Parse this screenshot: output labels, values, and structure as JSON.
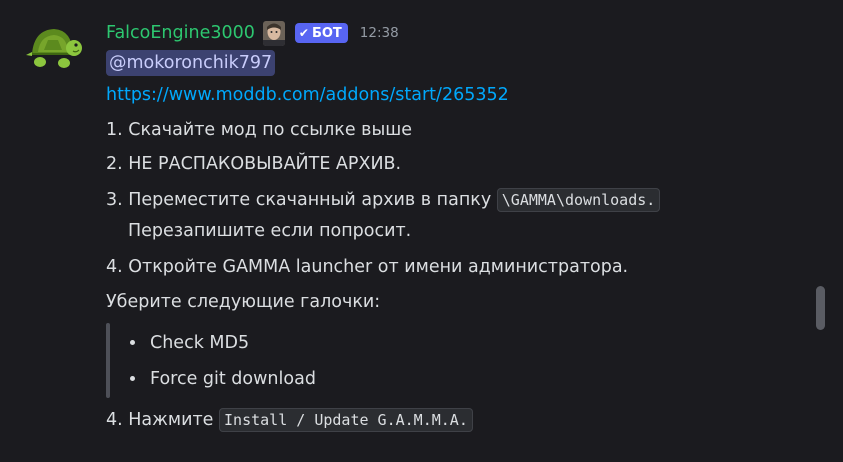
{
  "message": {
    "author": "FalcoEngine3000",
    "bot_tag": "БОТ",
    "bot_check": "✔",
    "timestamp": "12:38",
    "mention": "@mokoronchik797",
    "link": "https://www.moddb.com/addons/start/265352",
    "steps": {
      "s1": "1. Скачайте мод по ссылке выше",
      "s2": "2. НЕ РАСПАКОВЫВАЙТЕ АРХИВ.",
      "s3_prefix": "3. Переместите скачанный архив в папку ",
      "s3_code": "\\GAMMA\\downloads.",
      "s3_cont": "Перезапишите если попросит.",
      "s4": "4. Откройте GAMMA launcher от имени администратора.",
      "uncheck_intro": "Уберите следующие галочки:",
      "checks": [
        "Check MD5",
        "Force git download"
      ],
      "s5_prefix": "4. Нажмите ",
      "s5_code": "Install / Update G.A.M.M.A."
    }
  },
  "icons": {
    "avatar": "turtle-avatar",
    "role": "role-icon-face"
  },
  "colors": {
    "background": "#1b1b1f",
    "username": "#2dc770",
    "link": "#00a8fc",
    "bot_tag": "#5865f2",
    "mention_bg": "#3c4270"
  }
}
